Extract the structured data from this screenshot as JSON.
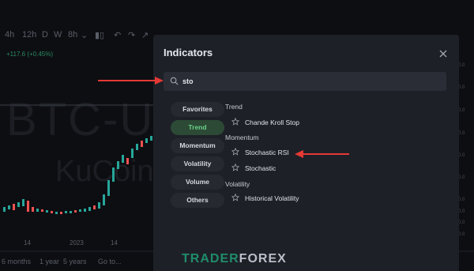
{
  "chart": {
    "toolbar": [
      "4h",
      "12h",
      "D",
      "W",
      "8h"
    ],
    "price_change": "+117.6 (+0.45%)",
    "watermark_symbol": "BTC-U",
    "watermark_exchange": "KuCoin",
    "x_labels": [
      "14",
      "2023",
      "14"
    ],
    "ranges": [
      "6 months",
      "1 year",
      "5 years",
      "Go to..."
    ],
    "y_labels": [
      "0.0",
      "0.0",
      "0.0",
      "0.0",
      "0.0",
      "0.0",
      "0.0",
      "0.0",
      "0.0",
      "0.0"
    ]
  },
  "dialog": {
    "title": "Indicators",
    "search": {
      "value": "sto",
      "placeholder": "Search"
    },
    "categories": [
      {
        "label": "Favorites"
      },
      {
        "label": "Trend",
        "active": true
      },
      {
        "label": "Momentum"
      },
      {
        "label": "Volatility"
      },
      {
        "label": "Volume"
      },
      {
        "label": "Others"
      }
    ],
    "groups": [
      {
        "name": "Trend",
        "items": [
          "Chande Kroll Stop"
        ]
      },
      {
        "name": "Momentum",
        "items": [
          "Stochastic RSI",
          "Stochastic"
        ]
      },
      {
        "name": "Volatility",
        "items": [
          "Historical Volatility"
        ]
      }
    ]
  },
  "watermark": {
    "part1": "TRADER",
    "part2": "FOREX"
  },
  "colors": {
    "annotation_arrow": "#e53935",
    "active_category_bg": "#2c4a35",
    "active_category_text": "#6ad08a",
    "candle_up": "#26a69a",
    "candle_down": "#ef5350"
  }
}
